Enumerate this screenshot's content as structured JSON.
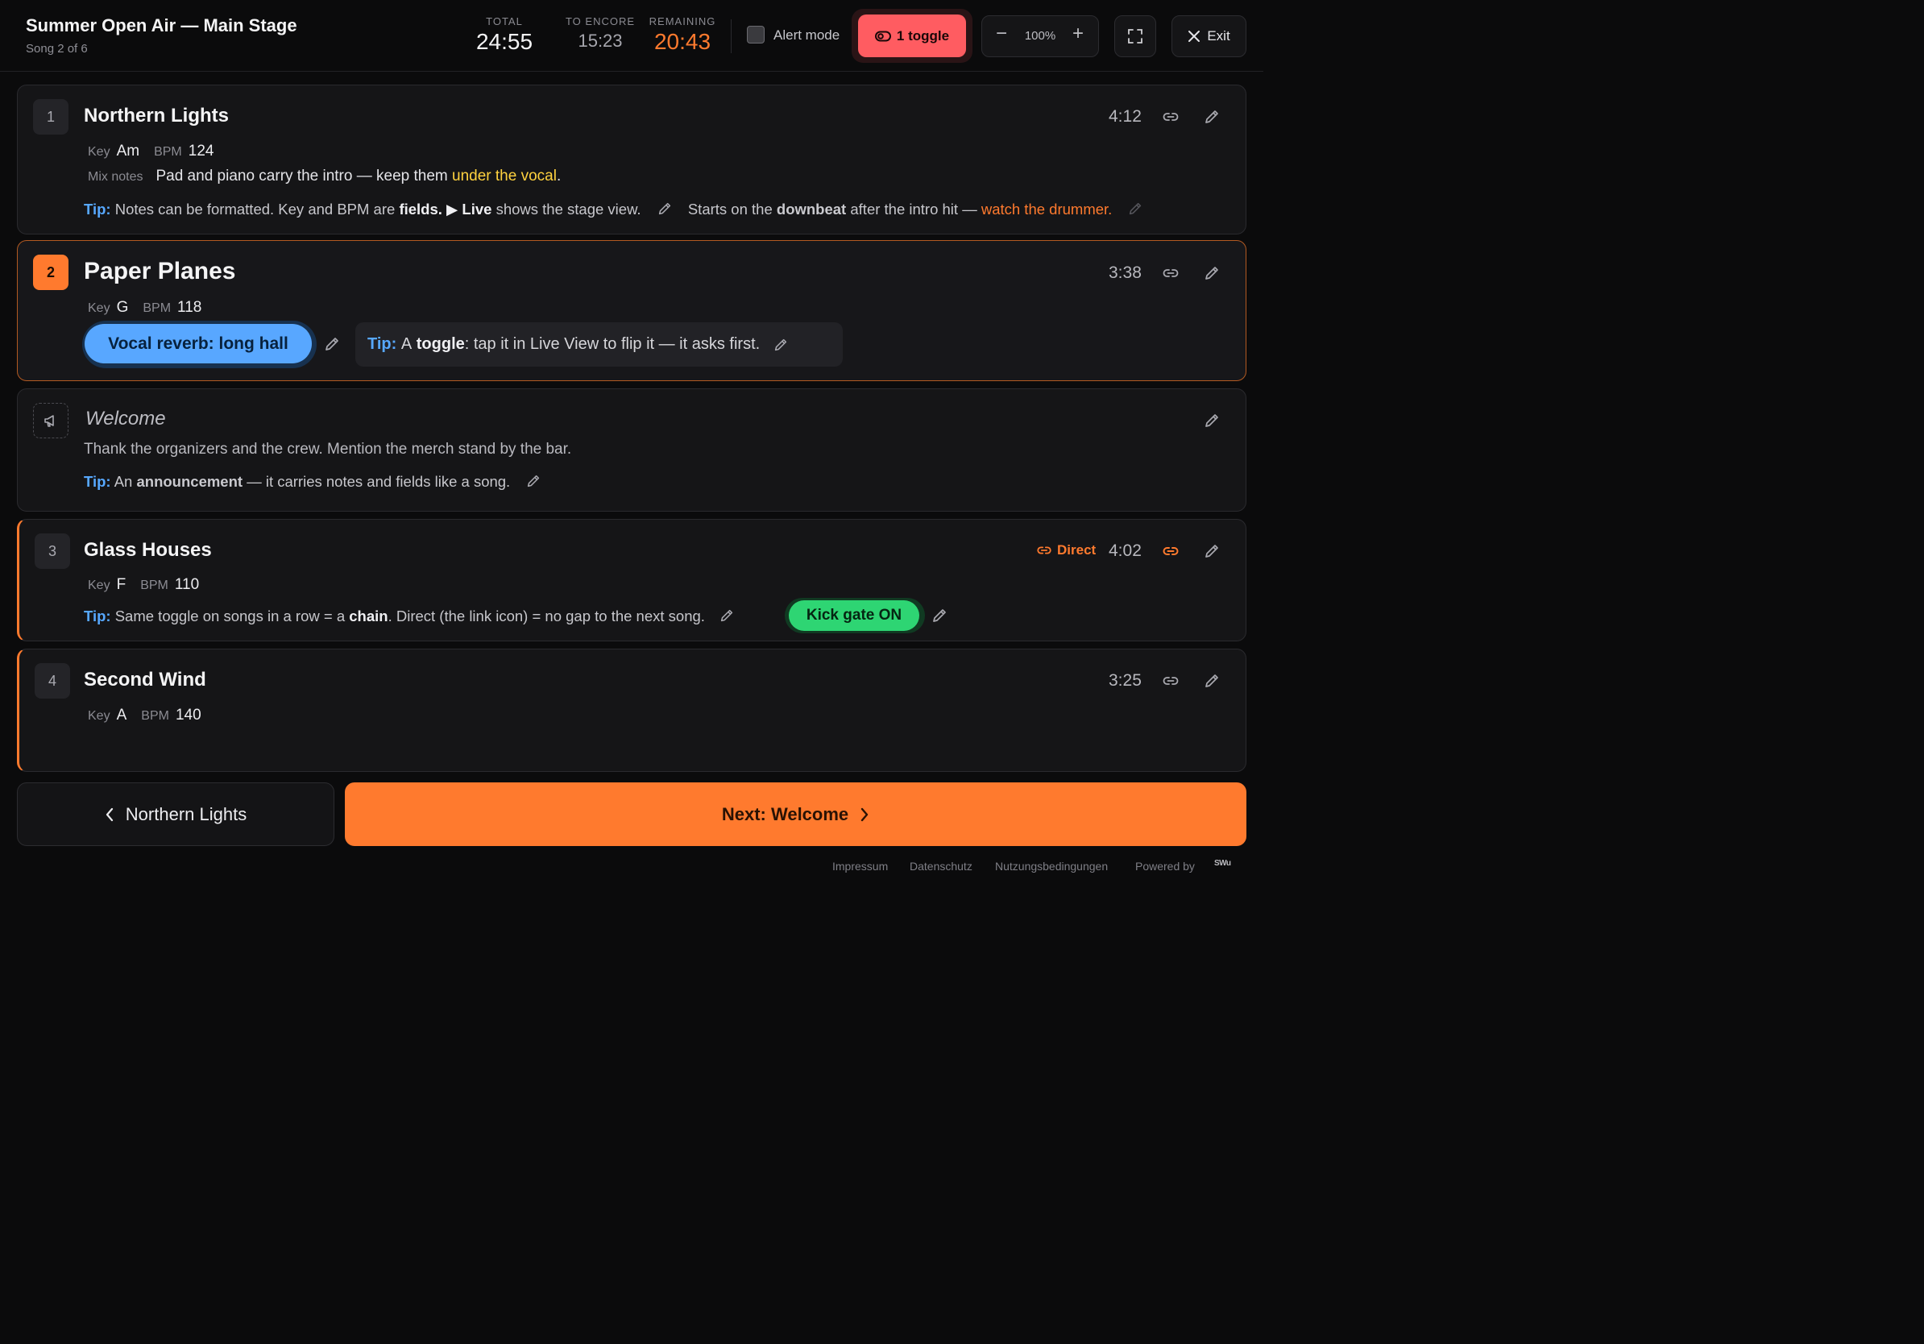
{
  "header": {
    "title": "Summer Open Air — Main Stage",
    "subtitle": "Song 2 of 6",
    "stats": {
      "total_label": "TOTAL",
      "total_value": "24:55",
      "encore_label": "TO ENCORE",
      "encore_value": "15:23",
      "remaining_label": "REMAINING",
      "remaining_value": "20:43"
    },
    "alert_mode_label": "Alert mode",
    "toggle_label": "1 toggle",
    "zoom_value": "100%",
    "zoom_minus": "−",
    "zoom_plus": "+",
    "exit_label": "Exit"
  },
  "songs": [
    {
      "number": "1",
      "title": "Northern Lights",
      "duration": "4:12",
      "key_label": "Key",
      "key": "Am",
      "bpm_label": "BPM",
      "bpm": "124",
      "mix_label": "Mix notes",
      "mix_text": "Pad and piano carry the intro — keep them",
      "mix_highlight": "under the vocal",
      "mix_end": ".",
      "tip_label": "Tip:",
      "tip_a": "Notes can be formatted. Key and BPM are",
      "tip_b": "fields",
      "tip_c": ". ▶",
      "tip_d": "Live",
      "tip_e": "shows the stage view.",
      "note2_a": "Starts on the",
      "note2_b": "downbeat",
      "note2_c": "after the intro hit —",
      "note2_d": "watch the drummer."
    },
    {
      "number": "2",
      "title": "Paper Planes",
      "duration": "3:38",
      "key_label": "Key",
      "key": "G",
      "bpm_label": "BPM",
      "bpm": "118",
      "toggle_pill": "Vocal reverb: long hall",
      "tip_label": "Tip:",
      "tip_a": "A",
      "tip_b": "toggle",
      "tip_c": ": tap it in Live View to flip it — it asks first."
    },
    {
      "number": "3",
      "title": "Glass Houses",
      "duration": "4:02",
      "direct_label": "Direct",
      "key_label": "Key",
      "key": "F",
      "bpm_label": "BPM",
      "bpm": "110",
      "tip_label": "Tip:",
      "tip_a": "Same toggle on songs in a row = a",
      "tip_b": "chain",
      "tip_c": ". Direct (the link icon) = no gap to the next song.",
      "toggle_pill": "Kick gate ON"
    },
    {
      "number": "4",
      "title": "Second Wind",
      "duration": "3:25",
      "key_label": "Key",
      "key": "A",
      "bpm_label": "BPM",
      "bpm": "140"
    }
  ],
  "announcement": {
    "title": "Welcome",
    "text": "Thank the organizers and the crew. Mention the merch stand by the bar.",
    "tip_label": "Tip:",
    "tip_a": "An",
    "tip_b": "announcement",
    "tip_c": "— it carries notes and fields like a song."
  },
  "nav": {
    "prev_label": "Northern Lights",
    "next_label": "Next: Welcome"
  },
  "footer": {
    "impressum": "Impressum",
    "datenschutz": "Datenschutz",
    "terms": "Nutzungsbedingungen",
    "powered_by": "Powered by",
    "brand": "SWu"
  },
  "colors": {
    "accent": "#ff7a2e",
    "toggle_red": "#ff5c61",
    "tip_blue": "#57a8ff",
    "pill_blue": "#58a7ff",
    "pill_green": "#2ed573",
    "highlight_yellow": "#ffd23f"
  }
}
